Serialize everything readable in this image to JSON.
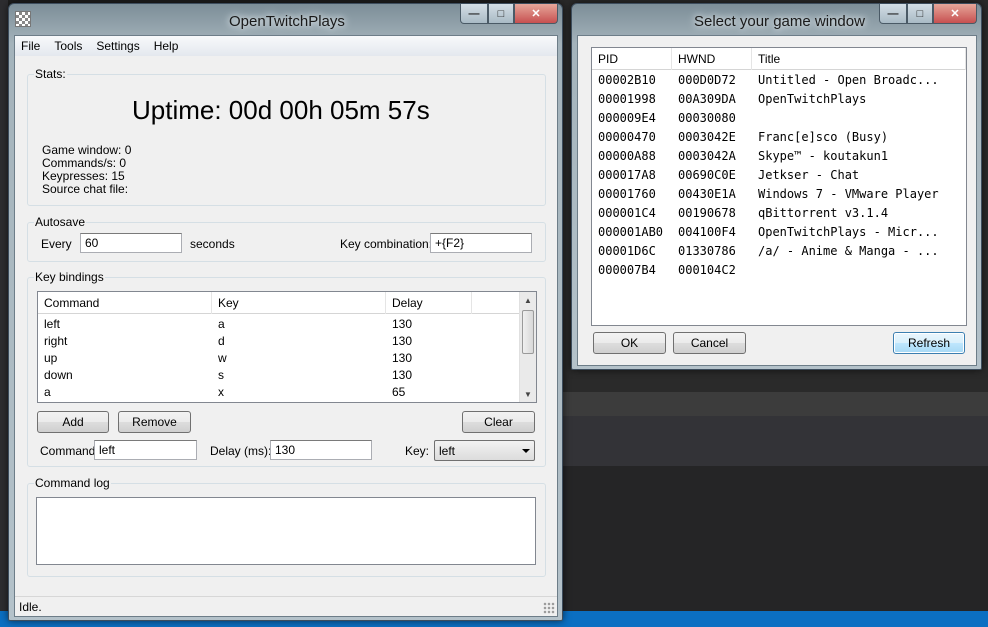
{
  "main_window": {
    "title": "OpenTwitchPlays",
    "caption": {
      "minimize": "—",
      "maximize": "□",
      "close": "✕"
    },
    "menu": [
      "File",
      "Tools",
      "Settings",
      "Help"
    ],
    "stats": {
      "label": "Stats:",
      "uptime": "Uptime: 00d 00h 05m 57s",
      "game_window": "Game window: 0",
      "commands_per_sec": "Commands/s: 0",
      "keypresses": "Keypresses: 15",
      "source_chat_file": "Source chat file:"
    },
    "autosave": {
      "label": "Autosave",
      "every_label": "Every",
      "every_value": "60",
      "seconds_label": "seconds",
      "key_combination_label": "Key combination:",
      "key_combination_value": "+{F2}"
    },
    "key_bindings": {
      "label": "Key bindings",
      "columns": [
        "Command",
        "Key",
        "Delay"
      ],
      "rows": [
        {
          "command": "left",
          "key": "a",
          "delay": "130"
        },
        {
          "command": "right",
          "key": "d",
          "delay": "130"
        },
        {
          "command": "up",
          "key": "w",
          "delay": "130"
        },
        {
          "command": "down",
          "key": "s",
          "delay": "130"
        },
        {
          "command": "a",
          "key": "x",
          "delay": "65"
        }
      ],
      "add_label": "Add",
      "remove_label": "Remove",
      "clear_label": "Clear",
      "command_label": "Command:",
      "command_value": "left",
      "delay_label": "Delay (ms):",
      "delay_value": "130",
      "key_label": "Key:",
      "key_value": "left"
    },
    "command_log": {
      "label": "Command log"
    },
    "status": "Idle."
  },
  "select_window": {
    "title": "Select your game window",
    "caption": {
      "minimize": "—",
      "maximize": "□",
      "close": "✕"
    },
    "columns": [
      "PID",
      "HWND",
      "Title"
    ],
    "rows": [
      {
        "pid": "00002B10",
        "hwnd": "000D0D72",
        "title": "Untitled - Open Broadc..."
      },
      {
        "pid": "00001998",
        "hwnd": "00A309DA",
        "title": "OpenTwitchPlays"
      },
      {
        "pid": "000009E4",
        "hwnd": "00030080",
        "title": ""
      },
      {
        "pid": "00000470",
        "hwnd": "0003042E",
        "title": "Franc[e]sco (Busy)"
      },
      {
        "pid": "00000A88",
        "hwnd": "0003042A",
        "title": "Skype™ - koutakun1"
      },
      {
        "pid": "000017A8",
        "hwnd": "00690C0E",
        "title": "Jetkser - Chat"
      },
      {
        "pid": "00001760",
        "hwnd": "00430E1A",
        "title": "Windows 7 - VMware Player"
      },
      {
        "pid": "000001C4",
        "hwnd": "00190678",
        "title": "qBittorrent v3.1.4"
      },
      {
        "pid": "000001AB0",
        "hwnd": "004100F4",
        "title": "OpenTwitchPlays - Micr..."
      },
      {
        "pid": "00001D6C",
        "hwnd": "01330786",
        "title": "/a/ - Anime & Manga - ..."
      },
      {
        "pid": "000007B4",
        "hwnd": "000104C2",
        "title": ""
      }
    ],
    "ok_label": "OK",
    "cancel_label": "Cancel",
    "refresh_label": "Refresh"
  }
}
